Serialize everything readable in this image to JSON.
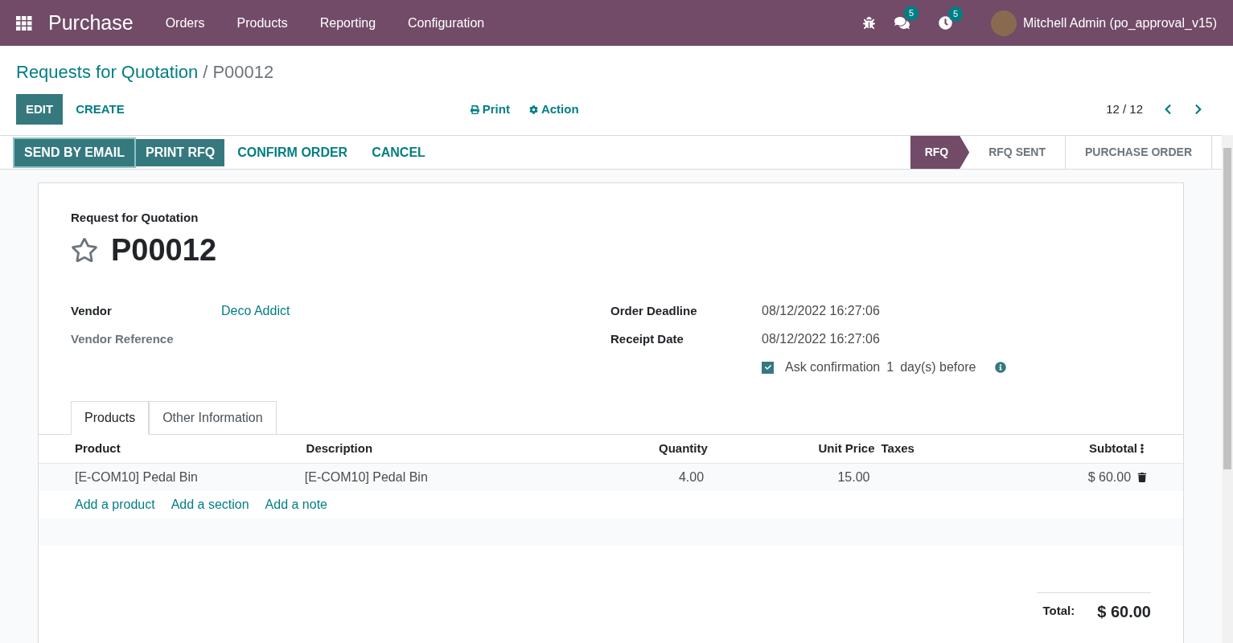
{
  "navbar": {
    "app_name": "Purchase",
    "menu": [
      "Orders",
      "Products",
      "Reporting",
      "Configuration"
    ],
    "messages_count": "5",
    "activities_count": "5",
    "user": "Mitchell Admin (po_approval_v15)"
  },
  "breadcrumb": {
    "parent": "Requests for Quotation",
    "separator": "/",
    "current": "P00012"
  },
  "control_panel": {
    "buttons": [
      {
        "label": "EDIT",
        "kind": "primary"
      },
      {
        "label": "CREATE",
        "kind": "link"
      }
    ],
    "print": "Print",
    "action": "Action",
    "pager": "12 / 12"
  },
  "header_buttons": [
    {
      "label": "SEND BY EMAIL",
      "kind": "primary",
      "focused": true
    },
    {
      "label": "PRINT RFQ",
      "kind": "primary",
      "focused": false
    },
    {
      "label": "CONFIRM ORDER",
      "kind": "link",
      "focused": false
    },
    {
      "label": "CANCEL",
      "kind": "link",
      "focused": false
    }
  ],
  "statusbar": [
    {
      "label": "RFQ",
      "selected": true
    },
    {
      "label": "RFQ SENT",
      "selected": false
    },
    {
      "label": "PURCHASE ORDER",
      "selected": false
    }
  ],
  "form": {
    "subtitle": "Request for Quotation",
    "name": "P00012",
    "starred": false,
    "left_fields": [
      {
        "label": "Vendor",
        "value": "Deco Addict",
        "muted": false
      },
      {
        "label": "Vendor Reference",
        "muted": true
      }
    ],
    "right_fields": [
      {
        "label": "Order Deadline",
        "value": "08/12/2022 16:27:06"
      },
      {
        "label": "Receipt Date",
        "value": "08/12/2022 16:27:06"
      }
    ],
    "ask_confirmation": {
      "checked": true,
      "label": "Ask confirmation",
      "days": "1",
      "suffix": "day(s) before"
    },
    "tabs": [
      {
        "label": "Products",
        "selected": true
      },
      {
        "label": "Other Information",
        "selected": false
      }
    ],
    "table": {
      "columns": [
        "Product",
        "Description",
        "Quantity",
        "Unit Price",
        "Taxes",
        "Subtotal"
      ],
      "rows": [
        {
          "product": "[E-COM10] Pedal Bin",
          "description": "[E-COM10] Pedal Bin",
          "quantity": "4.00",
          "unit_price": "15.00",
          "taxes": "",
          "subtotal": "$ 60.00"
        }
      ],
      "add_links": [
        "Add a product",
        "Add a section",
        "Add a note"
      ]
    },
    "total": {
      "label": "Total:",
      "value": "$ 60.00"
    }
  }
}
